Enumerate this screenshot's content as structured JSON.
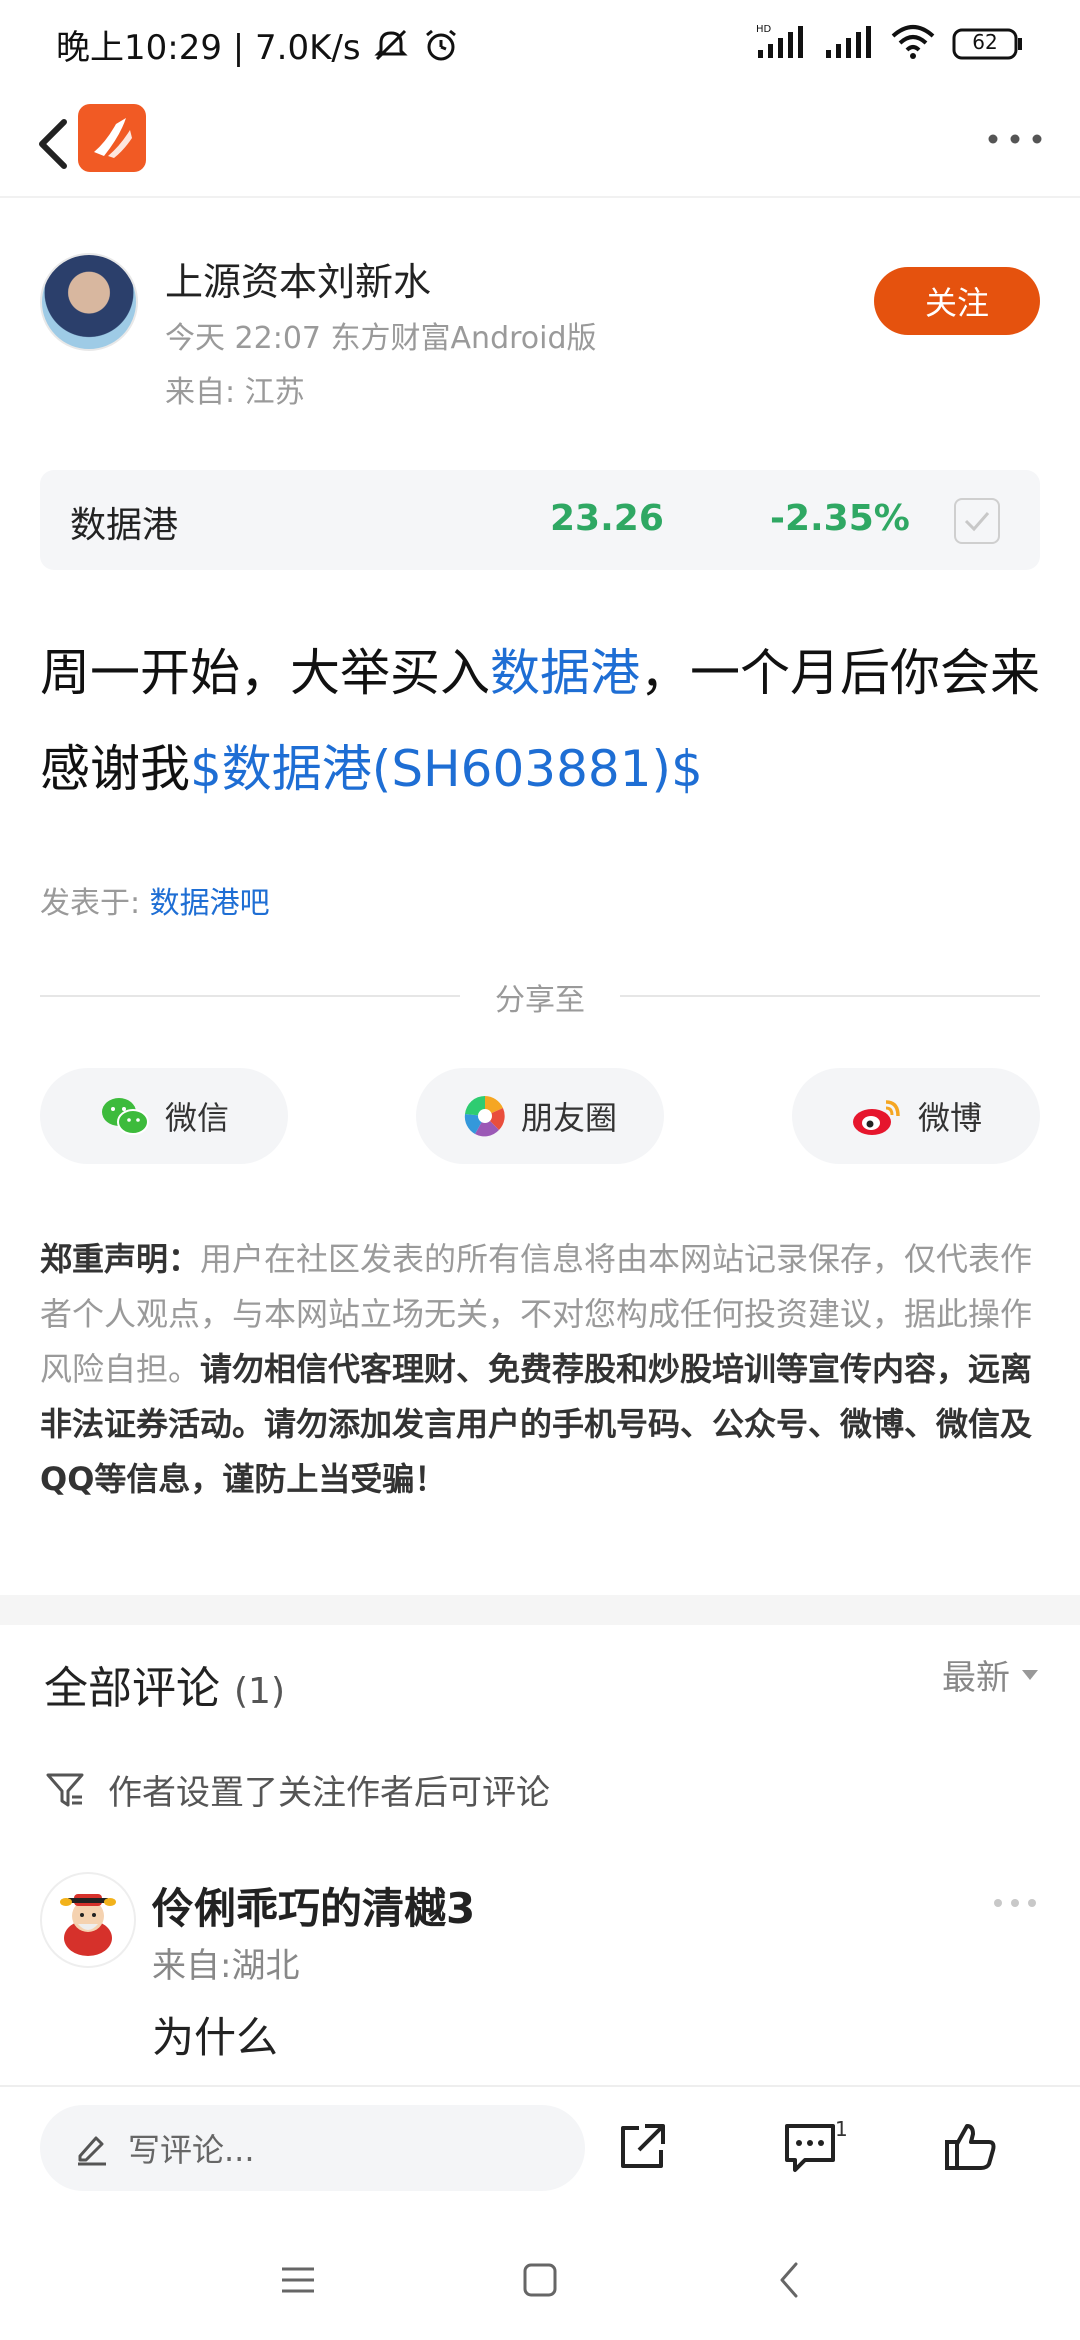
{
  "status_bar": {
    "time_speed": "晚上10:29 | 7.0K/s",
    "battery": "62"
  },
  "nav": {
    "app_logo": "east-money-logo-icon"
  },
  "author": {
    "name": "上源资本刘新水",
    "meta": "今天 22:07 东方财富Android版",
    "from": "来自: 江苏",
    "follow_label": "关注"
  },
  "stock": {
    "name": "数据港",
    "price": "23.26",
    "change": "-2.35%",
    "color": "#2fa863"
  },
  "post": {
    "text_a": "周一开始，大举买入",
    "link_a": "数据港",
    "text_b": "，一个月后你会来感谢我",
    "link_b": "$数据港(SH603881)$"
  },
  "posted_in": {
    "prefix": "发表于: ",
    "forum": "数据港吧"
  },
  "share": {
    "label": "分享至",
    "wechat": "微信",
    "moments": "朋友圈",
    "weibo": "微博"
  },
  "disclaimer": {
    "title": "郑重声明：",
    "gray_text": "用户在社区发表的所有信息将由本网站记录保存，仅代表作者个人观点，与本网站立场无关，不对您构成任何投资建议，据此操作风险自担。",
    "bold_text": "请勿相信代客理财、免费荐股和炒股培训等宣传内容，远离非法证券活动。请勿添加发言用户的手机号码、公众号、微博、微信及QQ等信息，谨防上当受骗！"
  },
  "comments": {
    "title": "全部评论",
    "count": "(1)",
    "sort": "最新",
    "notice": "作者设置了关注作者后可评论",
    "items": [
      {
        "name": "伶俐乖巧的清樾3",
        "from": "来自:湖北",
        "text": "为什么"
      }
    ]
  },
  "bottom_bar": {
    "input_placeholder": "写评论...",
    "comment_badge": "1"
  },
  "colors": {
    "accent": "#e5520e",
    "link": "#1e6ed4",
    "stock_down": "#2fa863"
  }
}
